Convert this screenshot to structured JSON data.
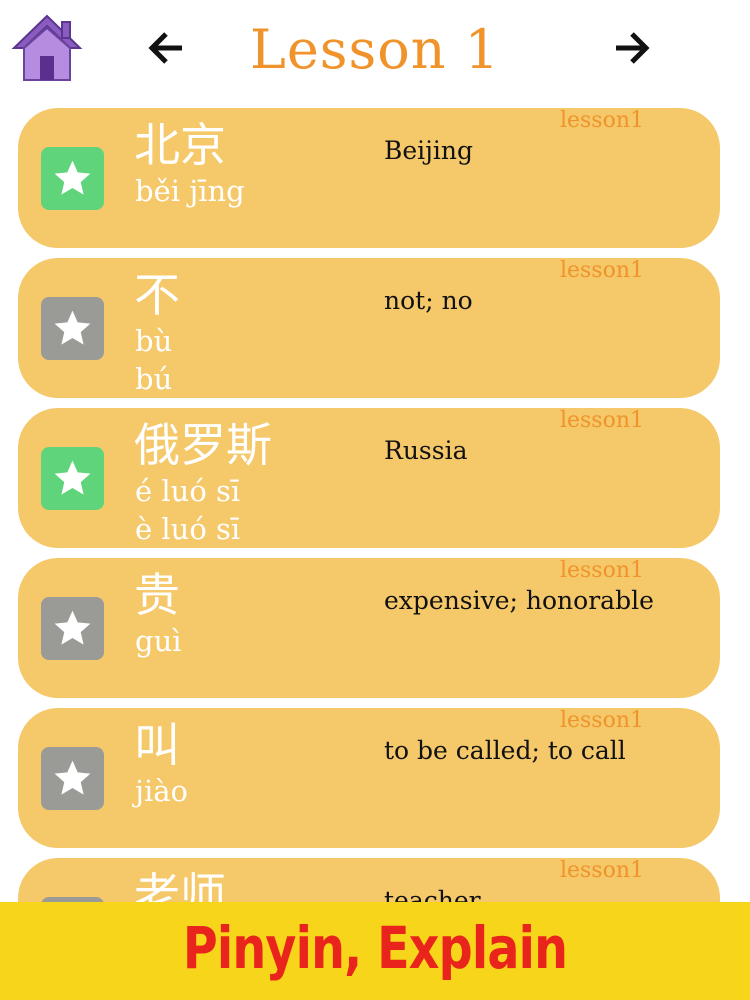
{
  "header": {
    "title": "Lesson 1",
    "home_icon": "home-icon",
    "back_icon": "arrow-left-icon",
    "forward_icon": "arrow-right-icon",
    "title_color": "#f0932a"
  },
  "words": [
    {
      "tag": "lesson1",
      "hanzi": "北京",
      "pinyin": [
        "běi jīng"
      ],
      "meaning": "Beijing",
      "favorite": true
    },
    {
      "tag": "lesson1",
      "hanzi": "不",
      "pinyin": [
        "bù",
        "bú"
      ],
      "meaning": "not; no",
      "favorite": false
    },
    {
      "tag": "lesson1",
      "hanzi": "俄罗斯",
      "pinyin": [
        "é luó sī",
        "è luó sī"
      ],
      "meaning": "Russia",
      "favorite": true
    },
    {
      "tag": "lesson1",
      "hanzi": "贵",
      "pinyin": [
        "guì"
      ],
      "meaning": "expensive; honorable",
      "favorite": false
    },
    {
      "tag": "lesson1",
      "hanzi": "叫",
      "pinyin": [
        "jiào"
      ],
      "meaning": "to be called; to call",
      "favorite": false
    },
    {
      "tag": "lesson1",
      "hanzi": "老师",
      "pinyin": [],
      "meaning": "teacher",
      "favorite": false
    }
  ],
  "banner": {
    "text": "Pinyin, Explain"
  },
  "colors": {
    "card": "#f5c86a",
    "favorite_star_bg": "#5fd47a",
    "plain_star_bg": "#9a9a96",
    "banner_bg": "#f7d51a",
    "banner_text": "#e8241c"
  }
}
